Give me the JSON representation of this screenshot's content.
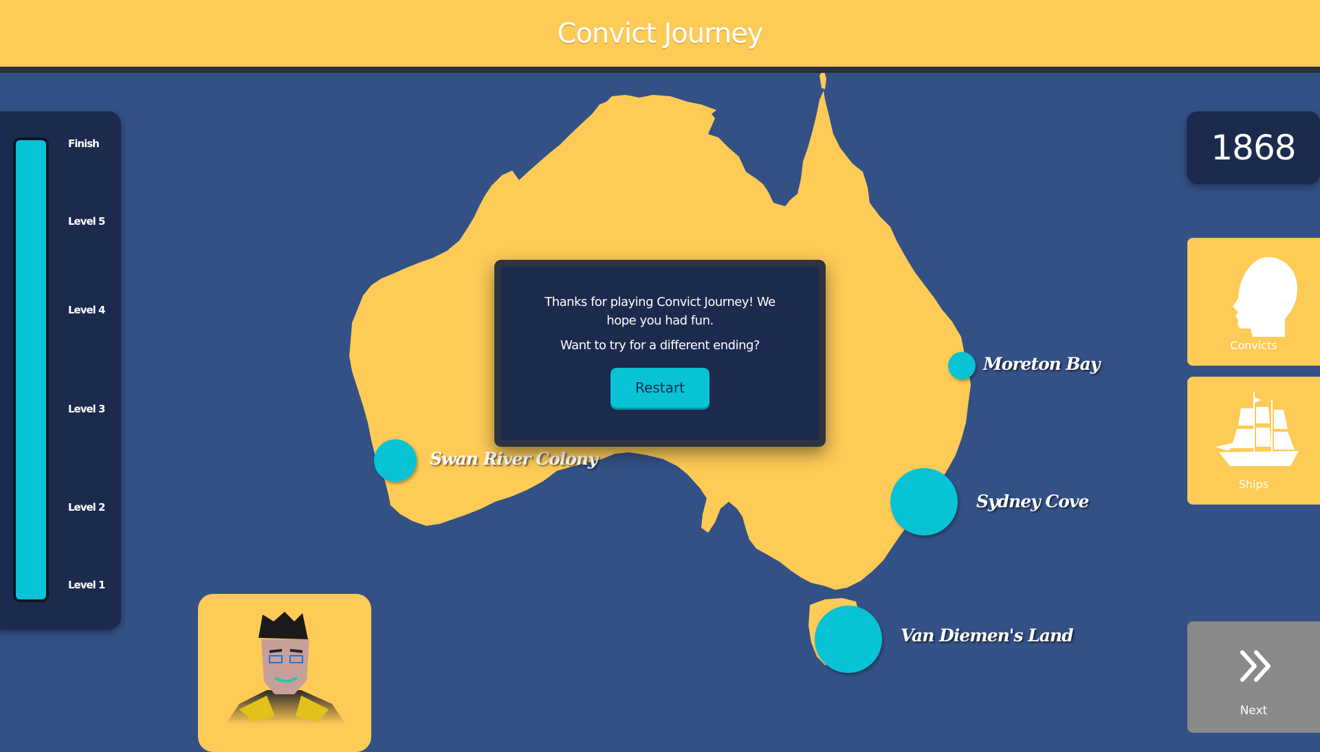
{
  "header": {
    "title": "Convict Journey"
  },
  "progress": {
    "levels": [
      "Finish",
      "Level 5",
      "Level 4",
      "Level 3",
      "Level 2",
      "Level 1"
    ],
    "fill_fraction": 1.0,
    "color": "#08C2D6"
  },
  "year": "1868",
  "locations": [
    {
      "name": "Moreton Bay"
    },
    {
      "name": "Swan River Colony"
    },
    {
      "name": "Sydney Cove"
    },
    {
      "name": "Van Diemen's Land"
    }
  ],
  "sidebar": {
    "convicts_label": "Convicts",
    "ships_label": "Ships",
    "next_label": "Next"
  },
  "dialog": {
    "message": "Thanks for playing Convict Journey! We hope you had fun.",
    "question": "Want to try for a different ending?",
    "restart_label": "Restart"
  },
  "colors": {
    "sea": "#335185",
    "land": "#FECB57",
    "panel": "#1C2A4E",
    "accent": "#08C2D6"
  },
  "icons": [
    "head-silhouette-icon",
    "sailing-ship-icon",
    "double-chevron-right-icon"
  ]
}
